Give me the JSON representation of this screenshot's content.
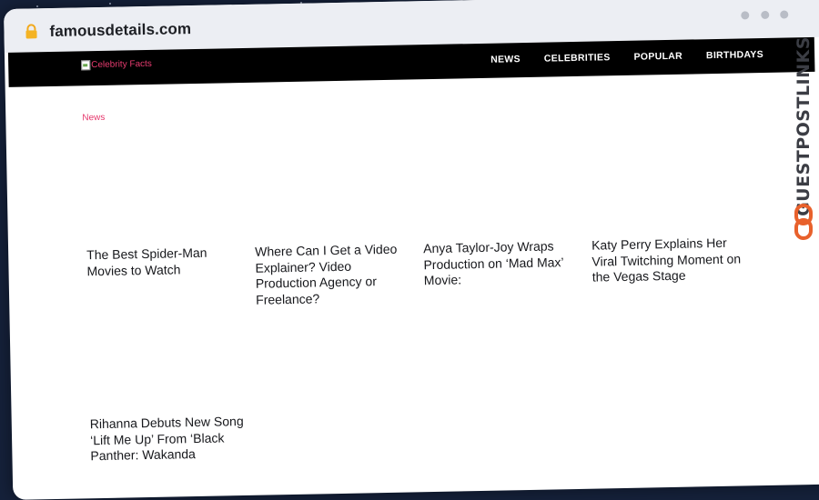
{
  "browser": {
    "url": "famousdetails.com"
  },
  "navbar": {
    "logo_alt": "Celebrity Facts",
    "links": [
      "NEWS",
      "CELEBRITIES",
      "POPULAR",
      "BIRTHDAYS"
    ]
  },
  "content": {
    "category": "News",
    "articles": [
      "The Best Spider-Man Movies to Watch",
      "Where Can I Get a Video Explainer? Video Production Agency or Freelance?",
      "Anya Taylor-Joy Wraps Production on ‘Mad Max’ Movie:",
      "Katy Perry Explains Her Viral Twitching Moment on the Vegas Stage",
      "Rihanna Debuts New Song ‘Lift Me Up’ From ‘Black Panther: Wakanda"
    ]
  },
  "watermark": {
    "text": "GUESTPOSTLINKS",
    "color": "#e8612c"
  },
  "colors": {
    "accent": "#e63b6f",
    "nav_bg": "#000000",
    "background": "#15213a"
  }
}
